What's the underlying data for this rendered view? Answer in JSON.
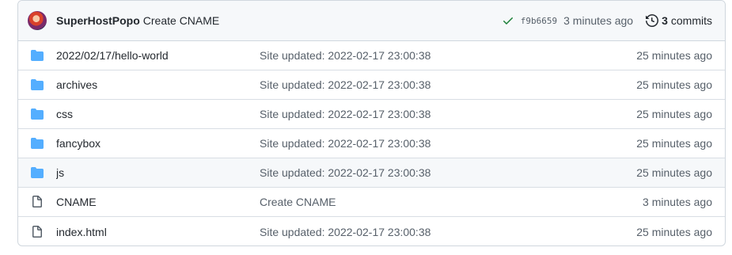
{
  "commit": {
    "author": "SuperHostPopo",
    "message": "Create CNAME",
    "sha": "f9b6659",
    "time_ago": "3 minutes ago",
    "commit_count": "3",
    "commit_label": "commits",
    "status": "success",
    "status_color": "#1a7f37"
  },
  "files": [
    {
      "name": "2022/02/17/hello-world",
      "type": "folder",
      "message": "Site updated: 2022-02-17 23:00:38",
      "age": "25 minutes ago"
    },
    {
      "name": "archives",
      "type": "folder",
      "message": "Site updated: 2022-02-17 23:00:38",
      "age": "25 minutes ago"
    },
    {
      "name": "css",
      "type": "folder",
      "message": "Site updated: 2022-02-17 23:00:38",
      "age": "25 minutes ago"
    },
    {
      "name": "fancybox",
      "type": "folder",
      "message": "Site updated: 2022-02-17 23:00:38",
      "age": "25 minutes ago"
    },
    {
      "name": "js",
      "type": "folder",
      "message": "Site updated: 2022-02-17 23:00:38",
      "age": "25 minutes ago"
    },
    {
      "name": "CNAME",
      "type": "file",
      "message": "Create CNAME",
      "age": "3 minutes ago"
    },
    {
      "name": "index.html",
      "type": "file",
      "message": "Site updated: 2022-02-17 23:00:38",
      "age": "25 minutes ago"
    }
  ],
  "colors": {
    "folder_icon": "#54aeff",
    "file_icon": "#57606a"
  }
}
